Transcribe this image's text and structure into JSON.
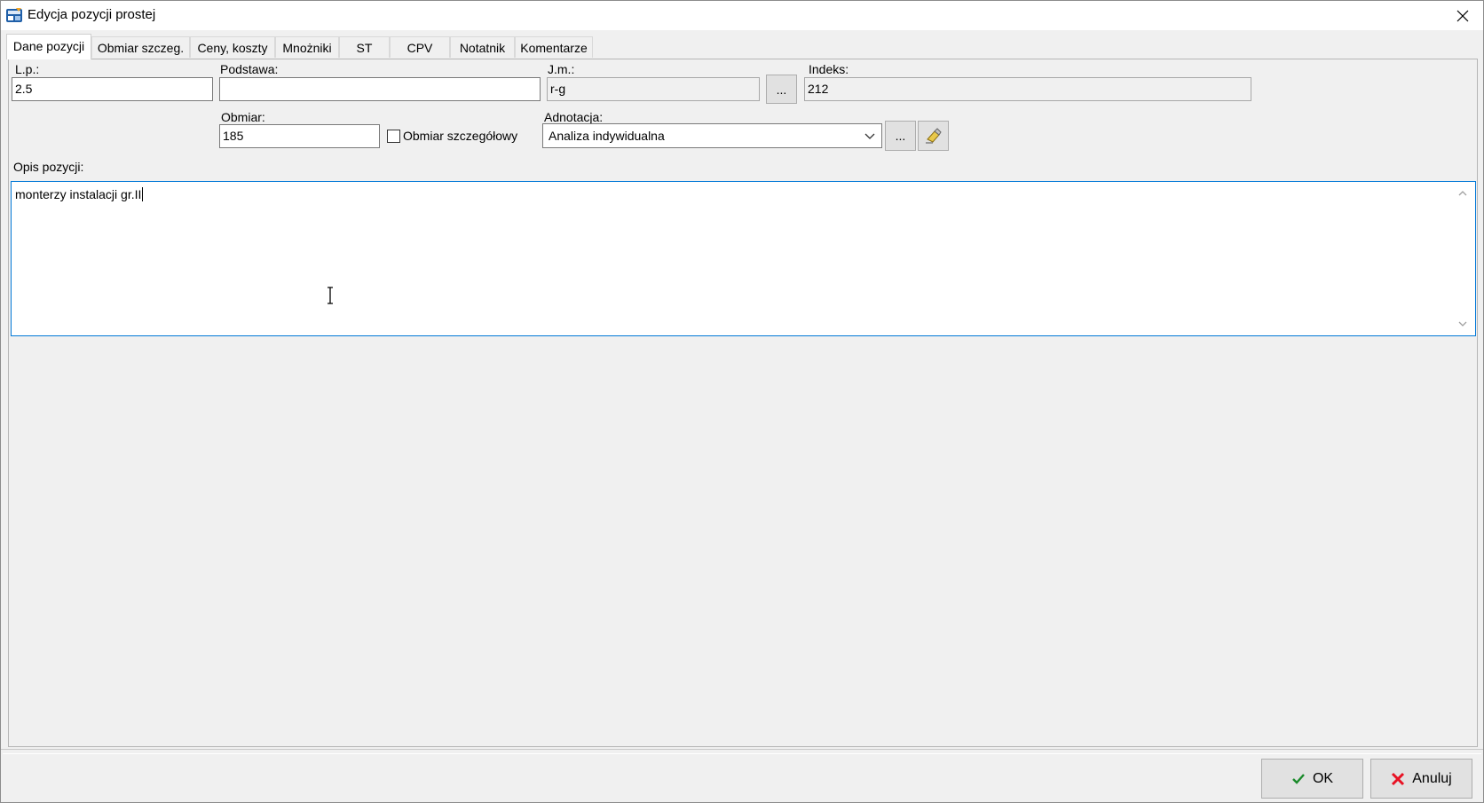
{
  "window": {
    "title": "Edycja pozycji prostej"
  },
  "tabs": [
    {
      "label": "Dane pozycji",
      "active": true
    },
    {
      "label": "Obmiar szczeg.",
      "active": false
    },
    {
      "label": "Ceny, koszty",
      "active": false
    },
    {
      "label": "Mnożniki",
      "active": false
    },
    {
      "label": "ST",
      "active": false
    },
    {
      "label": "CPV",
      "active": false
    },
    {
      "label": "Notatnik",
      "active": false
    },
    {
      "label": "Komentarze",
      "active": false
    }
  ],
  "form": {
    "lp_label": "L.p.:",
    "lp_value": "2.5",
    "podstawa_label": "Podstawa:",
    "podstawa_value": "",
    "jm_label": "J.m.:",
    "jm_value": "r-g",
    "jm_button": "...",
    "indeks_label": "Indeks:",
    "indeks_value": "212",
    "obmiar_label": "Obmiar:",
    "obmiar_value": "185",
    "obmiar_szczegolowy_label": "Obmiar szczegółowy",
    "obmiar_szczegolowy_checked": false,
    "adnotacja_label": "Adnotacja:",
    "adnotacja_value": "Analiza indywidualna",
    "adnotacja_button": "...",
    "opis_label": "Opis pozycji:",
    "opis_value": "monterzy instalacji gr.II"
  },
  "buttons": {
    "ok": "OK",
    "cancel": "Anuluj"
  },
  "colors": {
    "focus_border": "#0078d7",
    "ok_check": "#1a8a2a",
    "cancel_x": "#e81123"
  },
  "icons": {
    "app": "app-icon",
    "close": "close-icon",
    "clear": "eraser-icon",
    "dropdown": "chevron-down-icon",
    "ok": "checkmark-icon",
    "cancel": "x-icon"
  }
}
